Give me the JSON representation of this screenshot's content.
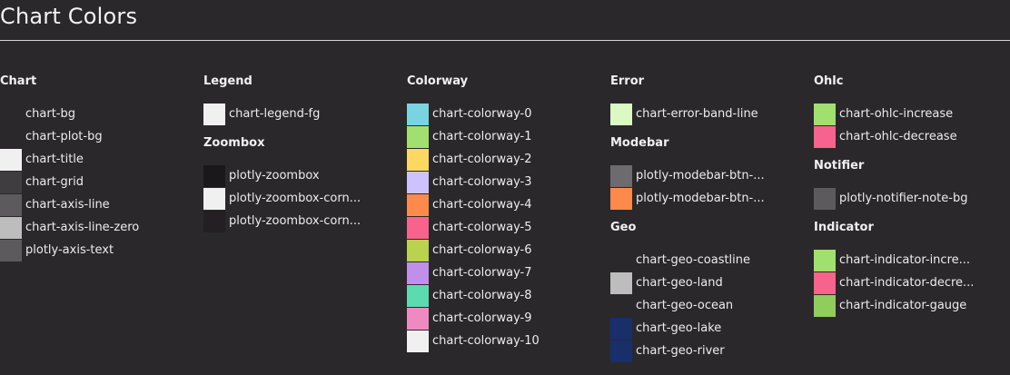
{
  "page": {
    "title": "Chart Colors"
  },
  "columns": [
    {
      "groups": [
        {
          "title": "Chart",
          "items": [
            {
              "label": "chart-bg",
              "color": "#2b282b"
            },
            {
              "label": "chart-plot-bg",
              "color": "#2b282b"
            },
            {
              "label": "chart-title",
              "color": "#f0f0f0"
            },
            {
              "label": "chart-grid",
              "color": "#403d40"
            },
            {
              "label": "chart-axis-line",
              "color": "#5c5a5c"
            },
            {
              "label": "chart-axis-line-zero",
              "color": "#bdbdbd"
            },
            {
              "label": "plotly-axis-text",
              "color": "#5c5a5c"
            }
          ]
        }
      ]
    },
    {
      "groups": [
        {
          "title": "Legend",
          "items": [
            {
              "label": "chart-legend-fg",
              "color": "#f0f0f0"
            }
          ]
        },
        {
          "title": "Zoombox",
          "items": [
            {
              "label": "plotly-zoombox",
              "color": "#1a181a"
            },
            {
              "label": "plotly-zoombox-corn...",
              "color": "#f0f0f0"
            },
            {
              "label": "plotly-zoombox-corn...",
              "color": "#231f23"
            }
          ]
        }
      ]
    },
    {
      "groups": [
        {
          "title": "Colorway",
          "items": [
            {
              "label": "chart-colorway-0",
              "color": "#78d4e0"
            },
            {
              "label": "chart-colorway-1",
              "color": "#a1df6e"
            },
            {
              "label": "chart-colorway-2",
              "color": "#fcd860"
            },
            {
              "label": "chart-colorway-3",
              "color": "#cec2fd"
            },
            {
              "label": "chart-colorway-4",
              "color": "#fd8a4a"
            },
            {
              "label": "chart-colorway-5",
              "color": "#f7638c"
            },
            {
              "label": "chart-colorway-6",
              "color": "#bad34e"
            },
            {
              "label": "chart-colorway-7",
              "color": "#c18ee9"
            },
            {
              "label": "chart-colorway-8",
              "color": "#5cdbb0"
            },
            {
              "label": "chart-colorway-9",
              "color": "#ee8ac2"
            },
            {
              "label": "chart-colorway-10",
              "color": "#f0f0f0"
            }
          ]
        }
      ]
    },
    {
      "groups": [
        {
          "title": "Error",
          "items": [
            {
              "label": "chart-error-band-line",
              "color": "#dcf9c4"
            }
          ]
        },
        {
          "title": "Modebar",
          "items": [
            {
              "label": "plotly-modebar-btn-...",
              "color": "#6e6b6e"
            },
            {
              "label": "plotly-modebar-btn-...",
              "color": "#fd8a4a"
            }
          ]
        },
        {
          "title": "Geo",
          "items": [
            {
              "label": "chart-geo-coastline",
              "color": "#2b282b"
            },
            {
              "label": "chart-geo-land",
              "color": "#bdbdbd"
            },
            {
              "label": "chart-geo-ocean",
              "color": "#2b282b"
            },
            {
              "label": "chart-geo-lake",
              "color": "#182f6b"
            },
            {
              "label": "chart-geo-river",
              "color": "#182f6b"
            }
          ]
        }
      ]
    },
    {
      "groups": [
        {
          "title": "Ohlc",
          "items": [
            {
              "label": "chart-ohlc-increase",
              "color": "#a1df6e"
            },
            {
              "label": "chart-ohlc-decrease",
              "color": "#f7638c"
            }
          ]
        },
        {
          "title": "Notifier",
          "items": [
            {
              "label": "plotly-notifier-note-bg",
              "color": "#5c5a5c"
            }
          ]
        },
        {
          "title": "Indicator",
          "items": [
            {
              "label": "chart-indicator-incre...",
              "color": "#a1df6e"
            },
            {
              "label": "chart-indicator-decre...",
              "color": "#f7638c"
            },
            {
              "label": "chart-indicator-gauge",
              "color": "#90cd5c"
            }
          ]
        }
      ]
    }
  ]
}
